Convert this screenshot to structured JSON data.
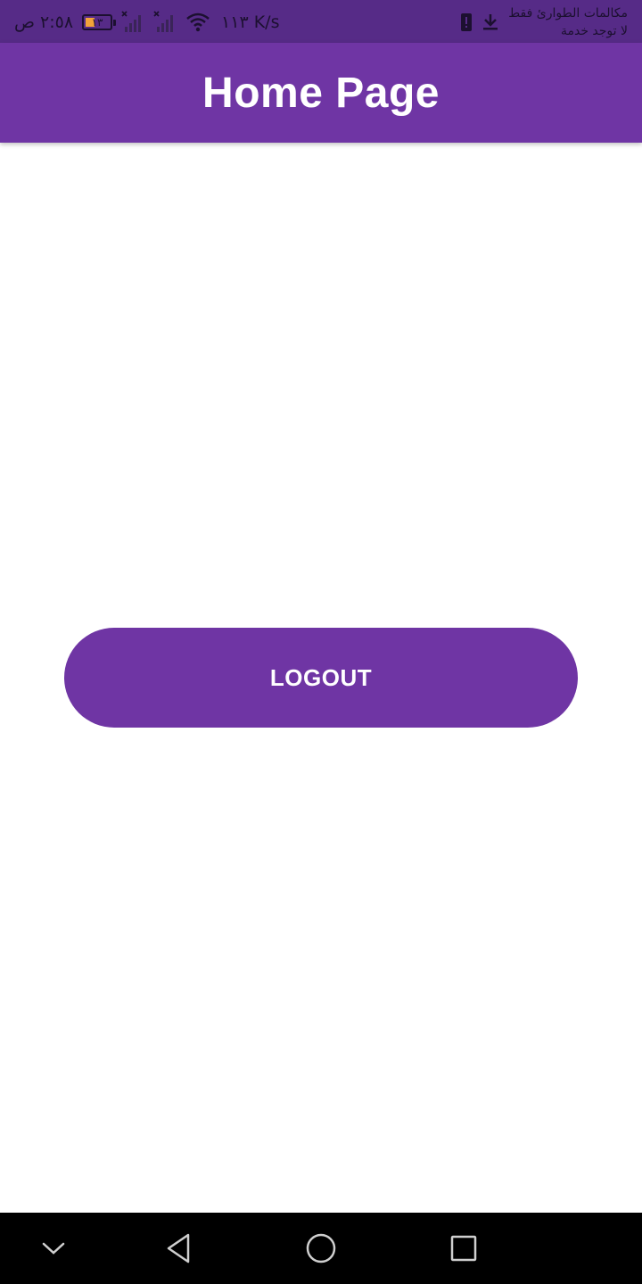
{
  "status_bar": {
    "time": "٢:٥٨ ص",
    "battery_level": "١٣",
    "battery_fill_fraction": 0.13,
    "net_speed": "١١٣ K/s",
    "notification_line1": "مكالمات الطوارئ فقط",
    "notification_line2": "لا توجد خدمة",
    "icons": [
      "battery-icon",
      "signal-no-service-icon",
      "signal-no-service-icon",
      "wifi-icon",
      "download-icon",
      "alert-icon"
    ]
  },
  "app_bar": {
    "title": "Home Page",
    "color": "#6f35a4"
  },
  "main": {
    "logout_label": "LOGOUT",
    "button_color": "#6f35a4"
  },
  "nav_bar": {
    "buttons": [
      "collapse-icon",
      "back-icon",
      "home-icon",
      "recents-icon"
    ]
  }
}
